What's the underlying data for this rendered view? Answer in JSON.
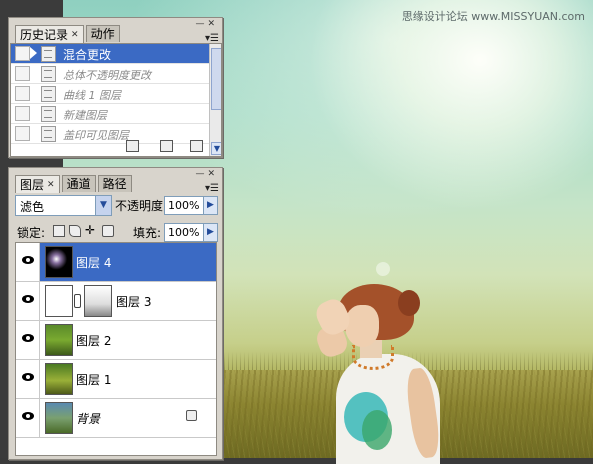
{
  "watermark": "思缘设计论坛  www.MISSYUAN.com",
  "history_panel": {
    "tabs": [
      {
        "label": "历史记录",
        "active": true
      },
      {
        "label": "动作",
        "active": false
      }
    ],
    "rows": [
      {
        "label": "混合更改",
        "selected": true
      },
      {
        "label": "总体不透明度更改",
        "selected": false
      },
      {
        "label": "曲线 1 图层",
        "selected": false
      },
      {
        "label": "新建图层",
        "selected": false
      },
      {
        "label": "盖印可见图层",
        "selected": false
      }
    ]
  },
  "layers_panel": {
    "tabs": [
      {
        "label": "图层",
        "active": true
      },
      {
        "label": "通道",
        "active": false
      },
      {
        "label": "路径",
        "active": false
      }
    ],
    "blend_mode": "滤色",
    "opacity_label": "不透明度:",
    "opacity_value": "100%",
    "lock_label": "锁定:",
    "fill_label": "填充:",
    "fill_value": "100%",
    "layers": [
      {
        "name": "图层 4",
        "selected": true,
        "thumb": "dark-flare"
      },
      {
        "name": "图层 3",
        "selected": false,
        "thumb": "white-with-mask"
      },
      {
        "name": "图层 2",
        "selected": false,
        "thumb": "photo"
      },
      {
        "name": "图层 1",
        "selected": false,
        "thumb": "photo"
      },
      {
        "name": "背景",
        "selected": false,
        "thumb": "photo",
        "locked": true
      }
    ]
  },
  "colors": {
    "selection": "#3b6ac4"
  }
}
